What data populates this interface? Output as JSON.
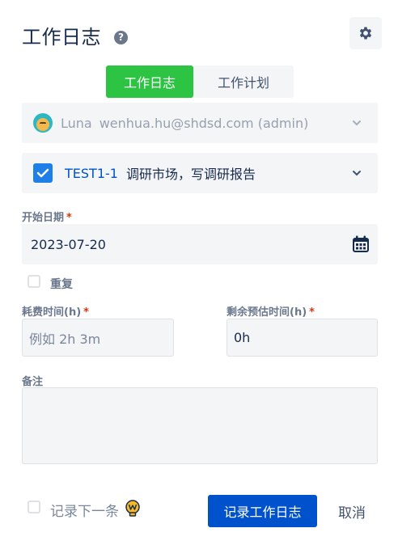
{
  "header": {
    "title": "工作日志",
    "help_symbol": "?",
    "settings_icon": "gear-icon"
  },
  "tabs": [
    {
      "label": "工作日志",
      "active": true
    },
    {
      "label": "工作计划",
      "active": false
    }
  ],
  "user": {
    "name": "Luna",
    "email": "wenhua.hu@shdsd.com (admin)"
  },
  "task": {
    "checked": true,
    "key": "TEST1-1",
    "summary": "调研市场，写调研报告"
  },
  "start_date": {
    "label": "开始日期",
    "value": "2023-07-20"
  },
  "repeat": {
    "label": "重复",
    "checked": false
  },
  "time_spent": {
    "label": "耗费时间(h)",
    "placeholder": "例如 2h 3m"
  },
  "remaining": {
    "label": "剩余预估时间(h)",
    "value": "0h"
  },
  "notes": {
    "label": "备注",
    "value": ""
  },
  "footer": {
    "log_next_label": "记录下一条",
    "log_next_checked": false,
    "submit_label": "记录工作日志",
    "cancel_label": "取消"
  },
  "required_mark": "*",
  "colors": {
    "accent_green": "#2ec443",
    "primary_blue": "#0052cc",
    "checkbox_blue": "#1e7fe6",
    "required_red": "#de350b"
  }
}
